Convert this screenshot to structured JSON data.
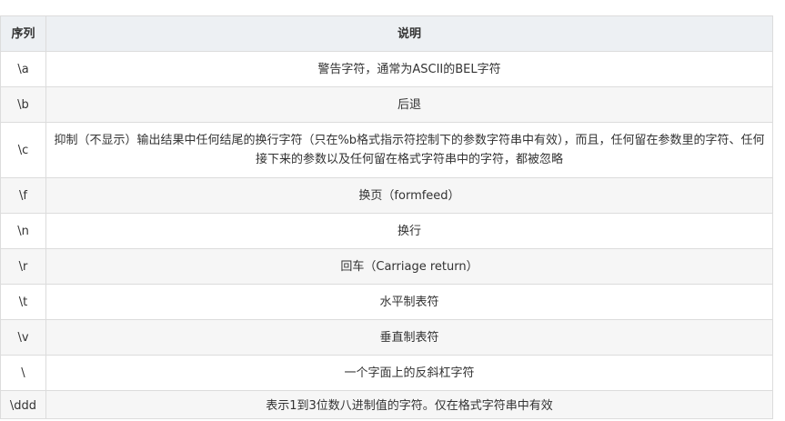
{
  "table": {
    "headers": [
      "序列",
      "说明"
    ],
    "rows": [
      {
        "code": "\\a",
        "desc": "警告字符，通常为ASCII的BEL字符"
      },
      {
        "code": "\\b",
        "desc": "后退"
      },
      {
        "code": "\\c",
        "desc": "抑制（不显示）输出结果中任何结尾的换行字符（只在%b格式指示符控制下的参数字符串中有效），而且，任何留在参数里的字符、任何接下来的参数以及任何留在格式字符串中的字符，都被忽略"
      },
      {
        "code": "\\f",
        "desc": "换页（formfeed）"
      },
      {
        "code": "\\n",
        "desc": "换行"
      },
      {
        "code": "\\r",
        "desc": "回车（Carriage return）"
      },
      {
        "code": "\\t",
        "desc": "水平制表符"
      },
      {
        "code": "\\v",
        "desc": "垂直制表符"
      },
      {
        "code": "\\",
        "desc": "一个字面上的反斜杠字符"
      },
      {
        "code": "\\ddd",
        "desc": "表示1到3位数八进制值的字符。仅在格式字符串中有效"
      }
    ]
  }
}
